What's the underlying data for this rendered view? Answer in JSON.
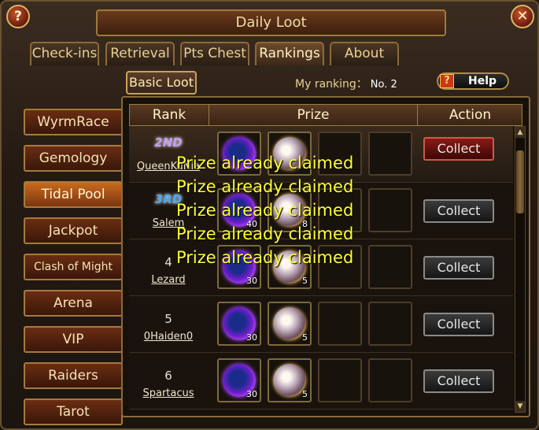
{
  "window": {
    "title": "Daily Loot",
    "help_corner": "?",
    "close_corner": "✕"
  },
  "tabs": [
    {
      "label": "Check-ins"
    },
    {
      "label": "Retrieval"
    },
    {
      "label": "Pts Chest"
    },
    {
      "label": "Rankings",
      "active": true
    },
    {
      "label": "About"
    }
  ],
  "subheader": {
    "basic_loot": "Basic Loot",
    "my_ranking_label": "My ranking：",
    "my_ranking_value": "No. 2",
    "help_label": "Help",
    "help_icon": "?"
  },
  "side_menu": [
    {
      "label": "WyrmRace"
    },
    {
      "label": "Gemology"
    },
    {
      "label": "Tidal Pool",
      "active": true
    },
    {
      "label": "Jackpot"
    },
    {
      "label": "Clash of Might"
    },
    {
      "label": "Arena"
    },
    {
      "label": "VIP"
    },
    {
      "label": "Raiders"
    },
    {
      "label": "Tarot"
    }
  ],
  "table": {
    "headers": {
      "rank": "Rank",
      "prize": "Prize",
      "action": "Action"
    },
    "rows": [
      {
        "rank": "2ND",
        "player": "QueenKuNia",
        "prize_qty": [
          "",
          ""
        ],
        "action": "Collect"
      },
      {
        "rank": "3RD",
        "player": "Salem",
        "prize_qty": [
          "40",
          "8"
        ],
        "action": "Collect"
      },
      {
        "rank": "4",
        "player": "Lezard",
        "prize_qty": [
          "30",
          "5"
        ],
        "action": "Collect"
      },
      {
        "rank": "5",
        "player": "0Haiden0",
        "prize_qty": [
          "30",
          "5"
        ],
        "action": "Collect"
      },
      {
        "rank": "6",
        "player": "Spartacus",
        "prize_qty": [
          "30",
          "5"
        ],
        "action": "Collect"
      }
    ]
  },
  "overlay": {
    "messages": [
      "Prize already claimed",
      "Prize already claimed",
      "Prize already claimed",
      "Prize already claimed",
      "Prize already claimed"
    ]
  },
  "scrollbar": {
    "up": "▲",
    "down": "▼"
  },
  "colors": {
    "accent_gold": "#e9cf94",
    "claimed_text": "#ffff33",
    "active_tab": "#c96a1e"
  }
}
